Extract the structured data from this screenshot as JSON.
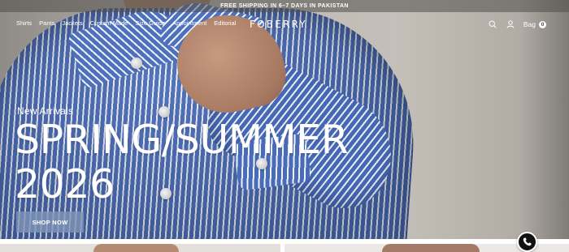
{
  "announcement": {
    "text": "FREE SHIPPING IN 6–7 DAYS IN PAKISTAN"
  },
  "nav": {
    "links": [
      "Shirts",
      "Pants",
      "Jackets",
      "Custom Made",
      "Size Guide",
      "Appointment",
      "Editorial"
    ],
    "logo": "FOBERRY",
    "bag_label": "Bag",
    "bag_count": "0",
    "icons": [
      "search-icon",
      "user-icon"
    ]
  },
  "hero": {
    "eyebrow": "New Arrivals",
    "headline_line1": "SPRING/SUMMER",
    "headline_line2": "2026",
    "cta_label": "SHOP NOW"
  },
  "floating": {
    "icon": "whatsapp-icon"
  },
  "colors": {
    "text_on_hero": "#ffffff",
    "cta_bg": "#8296b9",
    "shirt_blue": "#4a6cb8"
  }
}
